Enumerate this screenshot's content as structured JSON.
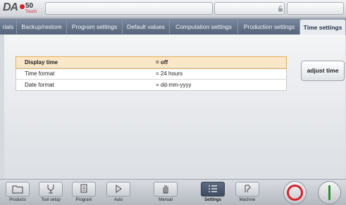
{
  "header": {
    "logo_text": "DA",
    "logo_number": "50",
    "logo_sub": "Touch"
  },
  "tabs": [
    {
      "label": "rials"
    },
    {
      "label": "Backup/restore"
    },
    {
      "label": "Program settings"
    },
    {
      "label": "Default values"
    },
    {
      "label": "Computation settings"
    },
    {
      "label": "Production settings"
    },
    {
      "label": "Time settings",
      "active": true
    }
  ],
  "settings": [
    {
      "label": "Display time",
      "value": "=  off",
      "selected": true
    },
    {
      "label": "Time format",
      "value": "=  24 hours"
    },
    {
      "label": "Date format",
      "value": "=  dd-mm-yyyy"
    }
  ],
  "actions": {
    "adjust_time": "adjust time"
  },
  "bottom_nav": [
    {
      "label": "Products",
      "icon": "folder-icon"
    },
    {
      "label": "Tool setup",
      "icon": "tool-icon"
    },
    {
      "label": "Program",
      "icon": "document-icon"
    },
    {
      "label": "Auto",
      "icon": "play-icon"
    },
    {
      "label": "Manual",
      "icon": "hand-icon"
    },
    {
      "label": "Settings",
      "icon": "list-icon",
      "active": true
    },
    {
      "label": "Machine",
      "icon": "machine-icon"
    }
  ],
  "colors": {
    "accent": "#d8202a",
    "selection": "#f9e7c8",
    "tab_bar": "#55637a",
    "start": "#2e8b3a"
  }
}
